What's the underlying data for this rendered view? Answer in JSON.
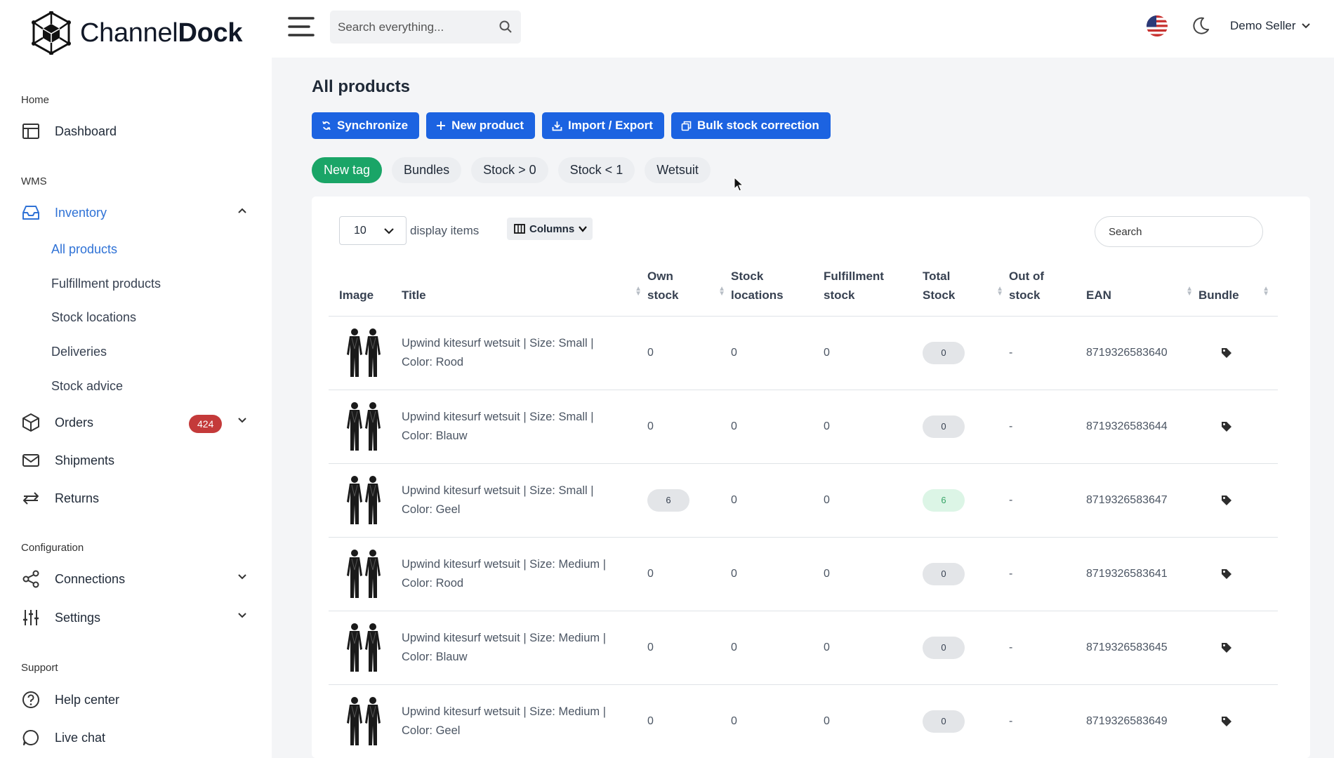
{
  "app": {
    "name_light": "Channel",
    "name_bold": "Dock"
  },
  "sidebar": {
    "sections": {
      "home": "Home",
      "wms": "WMS",
      "configuration": "Configuration",
      "support": "Support"
    },
    "dashboard": "Dashboard",
    "inventory": "Inventory",
    "inventory_sub": [
      "All products",
      "Fulfillment products",
      "Stock locations",
      "Deliveries",
      "Stock advice"
    ],
    "orders": "Orders",
    "orders_badge": "424",
    "shipments": "Shipments",
    "returns": "Returns",
    "connections": "Connections",
    "settings": "Settings",
    "help_center": "Help center",
    "live_chat": "Live chat"
  },
  "topbar": {
    "search_placeholder": "Search everything...",
    "user": "Demo Seller",
    "flag_icon": "us-flag-icon",
    "theme_icon": "moon-icon"
  },
  "page": {
    "title": "All products",
    "buttons": [
      "Synchronize",
      "New product",
      "Import / Export",
      "Bulk stock correction"
    ],
    "tags": [
      "New tag",
      "Bundles",
      "Stock > 0",
      "Stock < 1",
      "Wetsuit"
    ]
  },
  "table": {
    "per_page": "10",
    "display_items": "display items",
    "columns_btn": "Columns",
    "search_placeholder": "Search",
    "headers": {
      "image": "Image",
      "title": "Title",
      "own_stock_1": "Own",
      "own_stock_2": "stock",
      "stock_loc_1": "Stock",
      "stock_loc_2": "locations",
      "fulfil_1": "Fulfillment",
      "fulfil_2": "stock",
      "total_1": "Total",
      "total_2": "Stock",
      "oos_1": "Out of",
      "oos_2": "stock",
      "ean": "EAN",
      "bundle": "Bundle"
    },
    "rows": [
      {
        "title1": "Upwind kitesurf wetsuit | Size: Small |",
        "title2": "Color: Rood",
        "own_stock": "0",
        "stock_locations": "0",
        "fulfillment_stock": "0",
        "total_stock": "0",
        "out_of_stock": "-",
        "ean": "8719326583640"
      },
      {
        "title1": "Upwind kitesurf wetsuit | Size: Small |",
        "title2": "Color: Blauw",
        "own_stock": "0",
        "stock_locations": "0",
        "fulfillment_stock": "0",
        "total_stock": "0",
        "out_of_stock": "-",
        "ean": "8719326583644"
      },
      {
        "title1": "Upwind kitesurf wetsuit | Size: Small |",
        "title2": "Color: Geel",
        "own_stock": "6",
        "stock_locations": "0",
        "fulfillment_stock": "0",
        "total_stock": "6",
        "out_of_stock": "-",
        "ean": "8719326583647"
      },
      {
        "title1": "Upwind kitesurf wetsuit | Size: Medium |",
        "title2": "Color: Rood",
        "own_stock": "0",
        "stock_locations": "0",
        "fulfillment_stock": "0",
        "total_stock": "0",
        "out_of_stock": "-",
        "ean": "8719326583641"
      },
      {
        "title1": "Upwind kitesurf wetsuit | Size: Medium |",
        "title2": "Color: Blauw",
        "own_stock": "0",
        "stock_locations": "0",
        "fulfillment_stock": "0",
        "total_stock": "0",
        "out_of_stock": "-",
        "ean": "8719326583645"
      },
      {
        "title1": "Upwind kitesurf wetsuit | Size: Medium |",
        "title2": "Color: Geel",
        "own_stock": "0",
        "stock_locations": "0",
        "fulfillment_stock": "0",
        "total_stock": "0",
        "out_of_stock": "-",
        "ean": "8719326583649"
      }
    ]
  },
  "colors": {
    "primary": "#1c63e1",
    "active_nav": "#2f72d6",
    "tag_green": "#1aa567",
    "badge_red": "#c43a3a"
  }
}
